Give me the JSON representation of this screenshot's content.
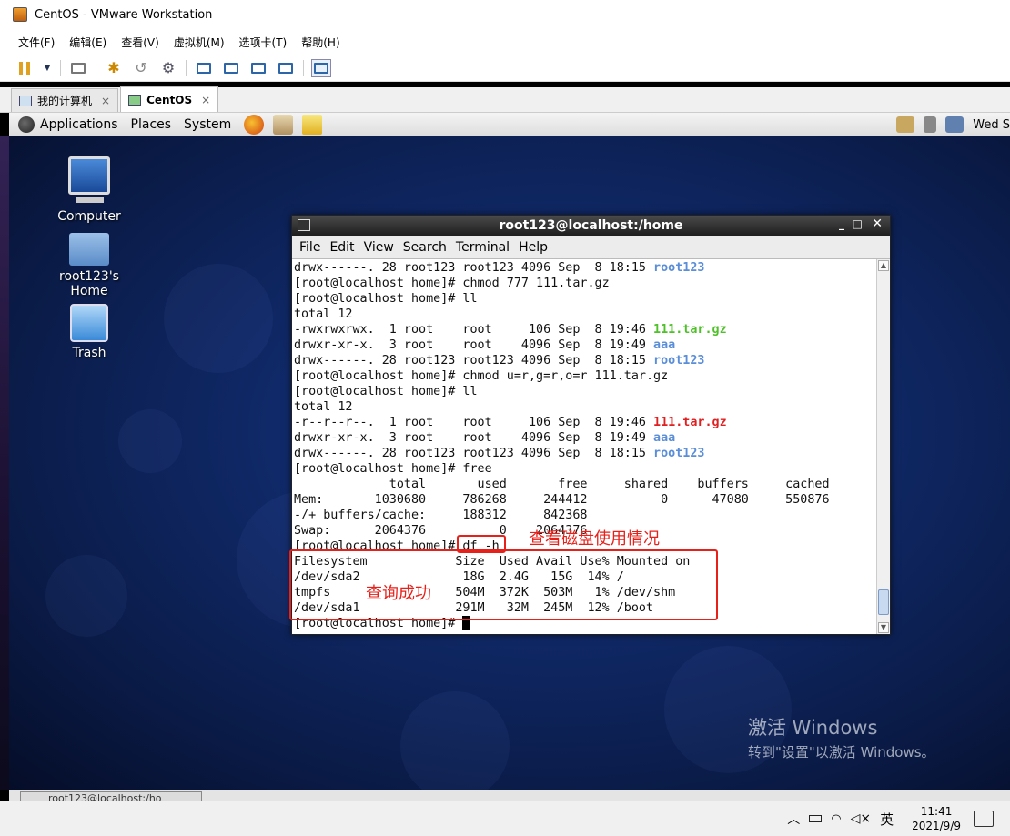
{
  "window": {
    "title": "CentOS - VMware Workstation"
  },
  "vmware_menu": [
    "文件(F)",
    "编辑(E)",
    "查看(V)",
    "虚拟机(M)",
    "选项卡(T)",
    "帮助(H)"
  ],
  "vm_tabs": [
    {
      "label": "我的计算机",
      "close": "×"
    },
    {
      "label": "CentOS",
      "close": "×"
    }
  ],
  "gnome_panel": {
    "menus": [
      "Applications",
      "Places",
      "System"
    ],
    "clock": "Wed S"
  },
  "desktop_icons": [
    {
      "label": "Computer",
      "icon": "computer-icon"
    },
    {
      "label": "root123's Home",
      "icon": "home-folder-icon"
    },
    {
      "label": "Trash",
      "icon": "trash-icon"
    }
  ],
  "terminal": {
    "title": "root123@localhost:/home",
    "menu": [
      "File",
      "Edit",
      "View",
      "Search",
      "Terminal",
      "Help"
    ],
    "lines": [
      {
        "text": "drwx------. 28 root123 root123 4096 Sep  8 18:15 ",
        "hl": "root123",
        "hl_class": "c-blue"
      },
      {
        "text": "[root@localhost home]# chmod 777 111.tar.gz"
      },
      {
        "text": "[root@localhost home]# ll"
      },
      {
        "text": "total 12"
      },
      {
        "text": "-rwxrwxrwx.  1 root    root     106 Sep  8 19:46 ",
        "hl": "111.tar.gz",
        "hl_class": "c-green"
      },
      {
        "text": "drwxr-xr-x.  3 root    root    4096 Sep  8 19:49 ",
        "hl": "aaa",
        "hl_class": "c-blue"
      },
      {
        "text": "drwx------. 28 root123 root123 4096 Sep  8 18:15 ",
        "hl": "root123",
        "hl_class": "c-blue"
      },
      {
        "text": "[root@localhost home]# chmod u=r,g=r,o=r 111.tar.gz"
      },
      {
        "text": "[root@localhost home]# ll"
      },
      {
        "text": "total 12"
      },
      {
        "text": "-r--r--r--.  1 root    root     106 Sep  8 19:46 ",
        "hl": "111.tar.gz",
        "hl_class": "c-red"
      },
      {
        "text": "drwxr-xr-x.  3 root    root    4096 Sep  8 19:49 ",
        "hl": "aaa",
        "hl_class": "c-blue"
      },
      {
        "text": "drwx------. 28 root123 root123 4096 Sep  8 18:15 ",
        "hl": "root123",
        "hl_class": "c-blue"
      },
      {
        "text": "[root@localhost home]# free"
      },
      {
        "text": "             total       used       free     shared    buffers     cached"
      },
      {
        "text": "Mem:       1030680     786268     244412          0      47080     550876"
      },
      {
        "text": "-/+ buffers/cache:     188312     842368"
      },
      {
        "text": "Swap:      2064376          0    2064376"
      },
      {
        "text": "[root@localhost home]# df -h"
      },
      {
        "text": "Filesystem            Size  Used Avail Use% Mounted on"
      },
      {
        "text": "/dev/sda2              18G  2.4G   15G  14% /"
      },
      {
        "text": "tmpfs                 504M  372K  503M   1% /dev/shm"
      },
      {
        "text": "/dev/sda1             291M   32M  245M  12% /boot"
      },
      {
        "text": "[root@localhost home]# ",
        "cursor": true
      }
    ]
  },
  "annotations": {
    "disk_usage": "查看磁盘使用情况",
    "query_ok": "查询成功"
  },
  "watermark": {
    "line1": "激活 Windows",
    "line2": "转到\"设置\"以激活 Windows。"
  },
  "guest_taskbar": {
    "item": "root123@localhost:/ho"
  },
  "taskbar": {
    "ime": "英",
    "time": "11:41",
    "date": "2021/9/9"
  }
}
